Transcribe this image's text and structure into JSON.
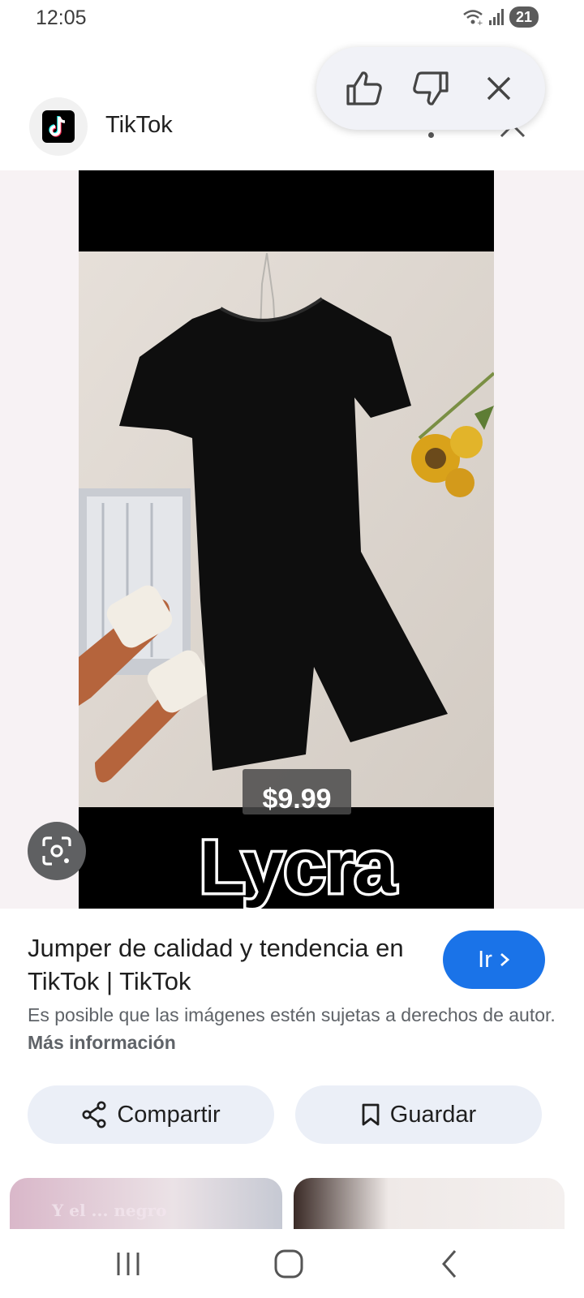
{
  "status_bar": {
    "time": "12:05",
    "battery": "21"
  },
  "header": {
    "source_name": "TikTok",
    "logo_icon": "tiktok-logo-icon"
  },
  "feedback": {
    "like_icon": "thumbs-up-icon",
    "dislike_icon": "thumbs-down-icon",
    "close_icon": "close-icon"
  },
  "image": {
    "price": "$9.99",
    "caption": "Lycra"
  },
  "result": {
    "title": "Jumper de calidad y tendencia en TikTok | TikTok",
    "go_label": "Ir",
    "copyright_text": "Es posible que las imágenes estén sujetas a derechos de autor.",
    "more_info": "Más información"
  },
  "actions": {
    "share_label": "Compartir",
    "save_label": "Guardar"
  },
  "thumbnails": [
    {
      "text": "Y el ... negro"
    }
  ],
  "colors": {
    "accent": "#1a73e8",
    "action_bg": "#ebeff7",
    "image_bg": "#f7f2f4"
  }
}
